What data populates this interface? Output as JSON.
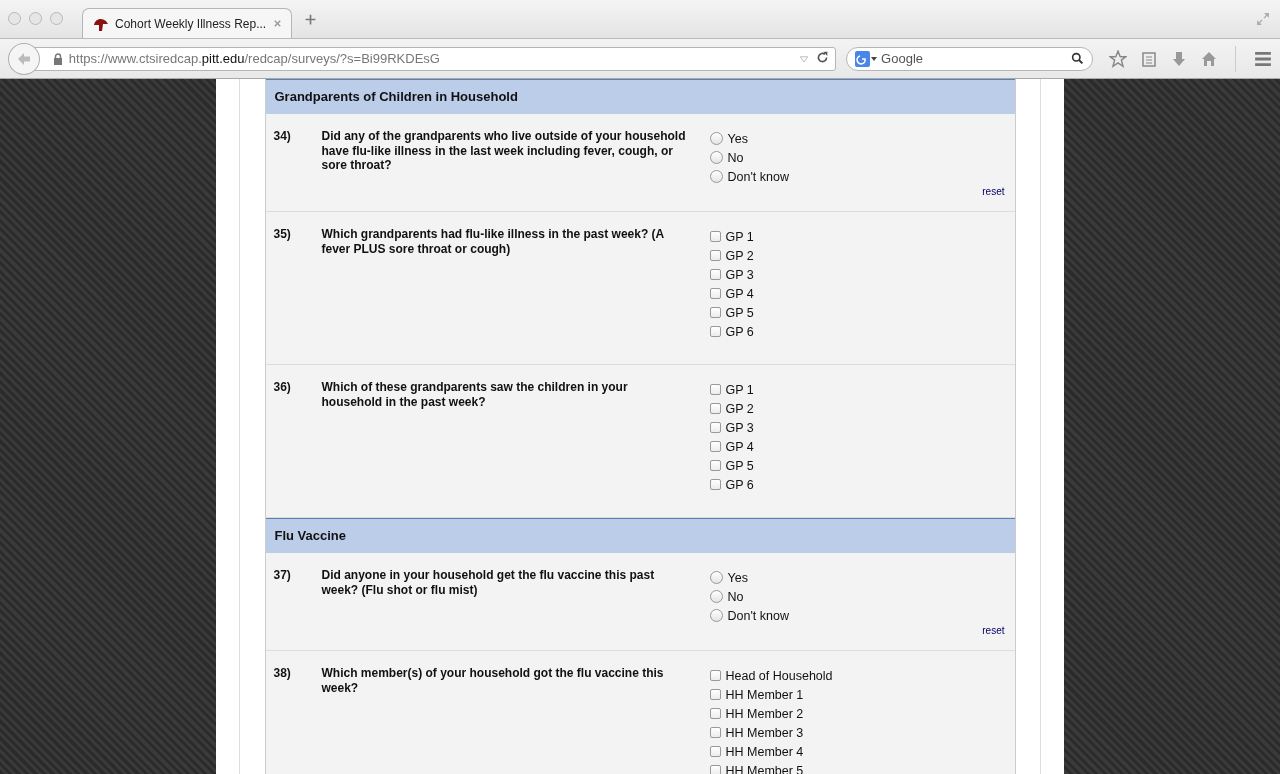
{
  "browser": {
    "tab_title": "Cohort Weekly Illness Rep...",
    "url_host": "https://www.ctsiredcap.",
    "url_domain": "pitt.edu",
    "url_path": "/redcap/surveys/?s=Bi99RKDEsG",
    "search_placeholder": "Google"
  },
  "sections": [
    {
      "title": "Grandparents of Children in Household",
      "questions": [
        {
          "number": "34)",
          "text": "Did any of the grandparents who live outside of your household have flu-like illness in the last week including fever, cough, or sore throat?",
          "kind": "radio",
          "reset": "reset",
          "options": [
            {
              "label": "Yes",
              "selected": false
            },
            {
              "label": "No",
              "selected": false
            },
            {
              "label": "Don't know",
              "selected": false
            }
          ]
        },
        {
          "number": "35)",
          "text": "Which grandparents had flu-like illness in the past week? (A fever PLUS sore throat or cough)",
          "kind": "checkbox",
          "options": [
            {
              "label": "GP 1",
              "checked": false
            },
            {
              "label": "GP 2",
              "checked": false
            },
            {
              "label": "GP 3",
              "checked": false
            },
            {
              "label": "GP 4",
              "checked": false
            },
            {
              "label": "GP 5",
              "checked": false
            },
            {
              "label": "GP 6",
              "checked": false
            }
          ]
        },
        {
          "number": "36)",
          "text": "Which of these grandparents saw the children in your household in the past week?",
          "kind": "checkbox",
          "options": [
            {
              "label": "GP 1",
              "checked": false
            },
            {
              "label": "GP 2",
              "checked": false
            },
            {
              "label": "GP 3",
              "checked": false
            },
            {
              "label": "GP 4",
              "checked": false
            },
            {
              "label": "GP 5",
              "checked": false
            },
            {
              "label": "GP 6",
              "checked": false
            }
          ]
        }
      ]
    },
    {
      "title": "Flu Vaccine",
      "questions": [
        {
          "number": "37)",
          "text": "Did anyone in your household get the flu vaccine this past week? (Flu shot or flu mist)",
          "kind": "radio",
          "reset": "reset",
          "options": [
            {
              "label": "Yes",
              "selected": false
            },
            {
              "label": "No",
              "selected": false
            },
            {
              "label": "Don't know",
              "selected": false
            }
          ]
        },
        {
          "number": "38)",
          "text": "Which member(s) of your household got the flu vaccine this week?",
          "kind": "checkbox",
          "options": [
            {
              "label": "Head of Household",
              "checked": false
            },
            {
              "label": "HH Member 1",
              "checked": false
            },
            {
              "label": "HH Member 2",
              "checked": false
            },
            {
              "label": "HH Member 3",
              "checked": false
            },
            {
              "label": "HH Member 4",
              "checked": false
            },
            {
              "label": "HH Member 5",
              "checked": false
            }
          ]
        }
      ]
    }
  ]
}
